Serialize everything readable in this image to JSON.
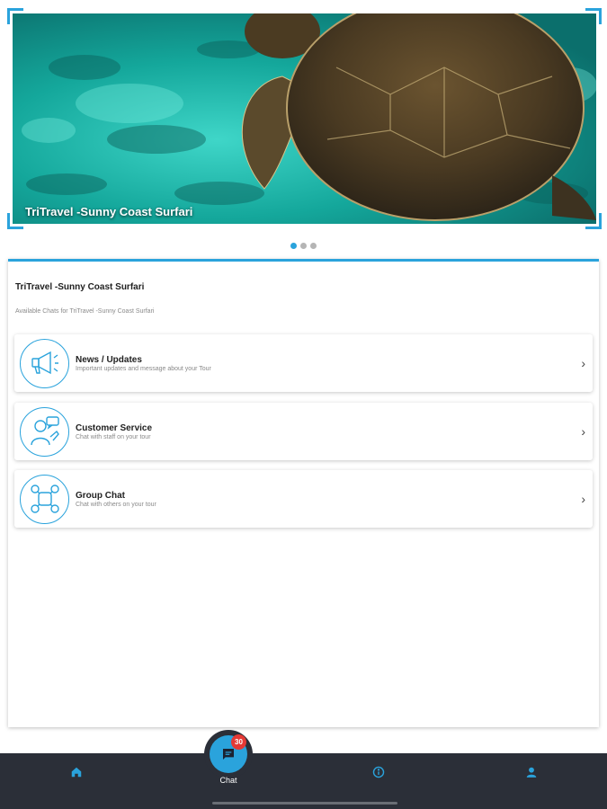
{
  "hero": {
    "caption": "TriTravel -Sunny Coast Surfari",
    "image_subject": "sea turtle swimming over turquoise reef",
    "slides_count": 3,
    "active_slide": 1
  },
  "tour": {
    "title": "TriTravel -Sunny Coast Surfari",
    "subtitle": "Available Chats for TriTravel -Sunny Coast Surfari"
  },
  "chats": [
    {
      "name": "News / Updates",
      "description": "Important updates and message about your Tour",
      "icon": "megaphone-icon"
    },
    {
      "name": "Customer Service",
      "description": "Chat with staff on your tour",
      "icon": "support-agent-icon"
    },
    {
      "name": "Group Chat",
      "description": "Chat with others on your tour",
      "icon": "group-icon"
    }
  ],
  "nav": {
    "chat_label": "Chat",
    "chat_badge": "30"
  },
  "colors": {
    "accent": "#2aa3dc",
    "nav_bg": "#2b2f38",
    "badge": "#e53935"
  }
}
